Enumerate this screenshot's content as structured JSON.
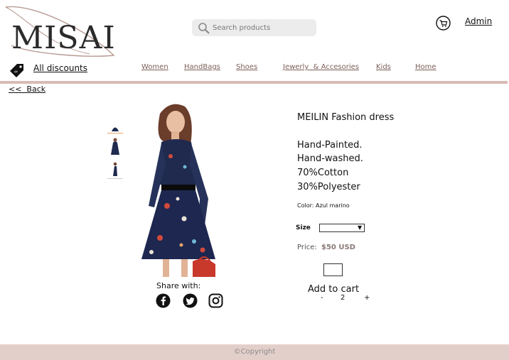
{
  "header": {
    "logo_text": "MISAI",
    "search_placeholder": "Search products",
    "admin_label": "Admin",
    "discounts_label": "All discounts"
  },
  "nav": {
    "items": [
      {
        "label": "Women"
      },
      {
        "label": "HandBags"
      },
      {
        "label": "Shoes"
      },
      {
        "label": "Jewerly  & Accesories"
      },
      {
        "label": "Kids"
      },
      {
        "label": "Home"
      }
    ]
  },
  "back_label": "<<  Back",
  "gallery": {
    "share_label": "Share with:",
    "social": [
      "facebook-icon",
      "twitter-icon",
      "instagram-icon"
    ]
  },
  "product": {
    "title": "MEILIN Fashion dress",
    "description": [
      "Hand-Painted.",
      "Hand-washed.",
      "70%Cotton",
      "30%Polyester"
    ],
    "color_line": "Color: Azul marino",
    "size_label": "Size",
    "size_selected": "",
    "price_label": "Price:",
    "price_value": "$50 USD",
    "add_to_cart": "Add to cart",
    "qty_minus": "-",
    "qty_value": "2",
    "qty_plus": "+"
  },
  "footer": {
    "copyright": "©Copyright"
  },
  "colors": {
    "divider": "#d8bbb5",
    "footer": "#e3cfca",
    "nav_text": "#7b5f58",
    "search_bg": "#ececec"
  }
}
